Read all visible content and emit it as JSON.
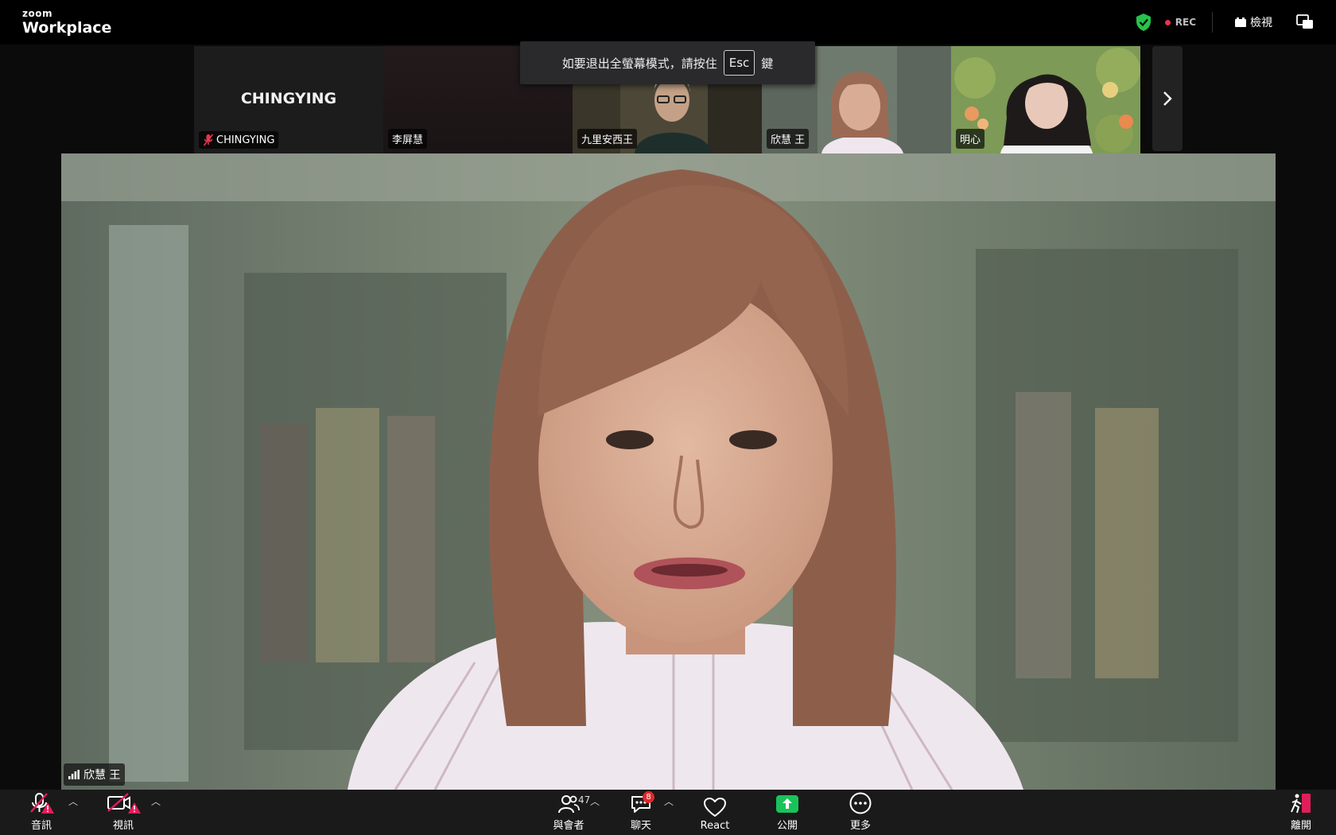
{
  "topbar": {
    "brand_small": "zoom",
    "brand_big": "Workplace",
    "rec_label": "REC",
    "view_label": "檢視"
  },
  "toast": {
    "before": "如要退出全螢幕模式，請按住",
    "key": "Esc",
    "after": "鍵"
  },
  "thumbnails": [
    {
      "name": "CHINGYING",
      "display_text": "CHINGYING",
      "muted": true
    },
    {
      "name": "李屏慧"
    },
    {
      "name": "九里安西王"
    },
    {
      "name": "欣慧 王",
      "active": true
    },
    {
      "name": "明心"
    }
  ],
  "main": {
    "speaker_name": "欣慧 王"
  },
  "toolbar": {
    "audio_label": "音訊",
    "video_label": "視訊",
    "participants_label": "與會者",
    "participants_count": "47",
    "chat_label": "聊天",
    "chat_badge": "8",
    "react_label": "React",
    "share_label": "公開",
    "more_label": "更多",
    "leave_label": "離開"
  },
  "colors": {
    "active_border": "#27c24c",
    "rec_dot": "#e8364b",
    "share_green": "#19c35a",
    "alert_red": "#e01e5a"
  }
}
